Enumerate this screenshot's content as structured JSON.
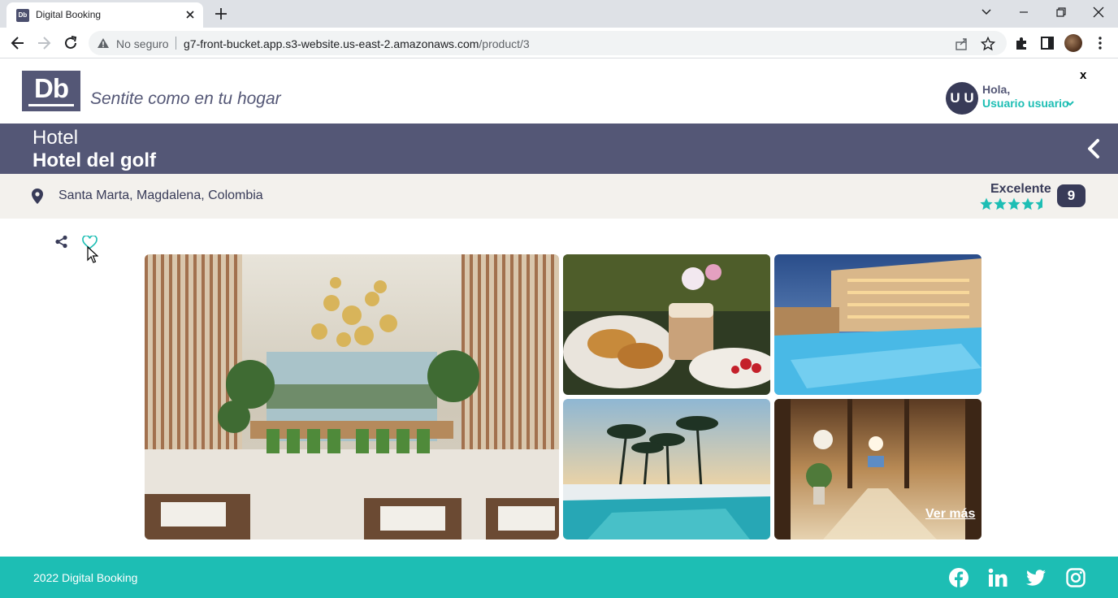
{
  "browser": {
    "tab_title": "Digital Booking",
    "tab_favicon": "Db",
    "omnibox": {
      "security_label": "No seguro",
      "url_host": "g7-front-bucket.app.s3-website.us-east-2.amazonaws.com",
      "url_path": "/product/3"
    }
  },
  "header": {
    "logo_text": "Db",
    "slogan": "Sentite como en tu hogar",
    "user": {
      "initials": "U U",
      "greeting": "Hola,",
      "name": "Usuario usuario"
    },
    "close_label": "x"
  },
  "product": {
    "category": "Hotel",
    "name": "Hotel del golf",
    "location": "Santa Marta, Magdalena, Colombia",
    "rating_label": "Excelente",
    "stars": 4.5,
    "score": "9"
  },
  "gallery": {
    "see_more": "Ver más",
    "images": [
      "hotel-lobby-dining",
      "breakfast",
      "pool-night",
      "palm-pool",
      "hotel-hallway"
    ]
  },
  "footer": {
    "copyright": "2022 Digital Booking",
    "social": [
      "facebook-icon",
      "linkedin-icon",
      "twitter-icon",
      "instagram-icon"
    ]
  },
  "colors": {
    "primary": "#545776",
    "dark": "#383b58",
    "accent": "#1dbeb4",
    "location_bg": "#f3f1ed"
  }
}
